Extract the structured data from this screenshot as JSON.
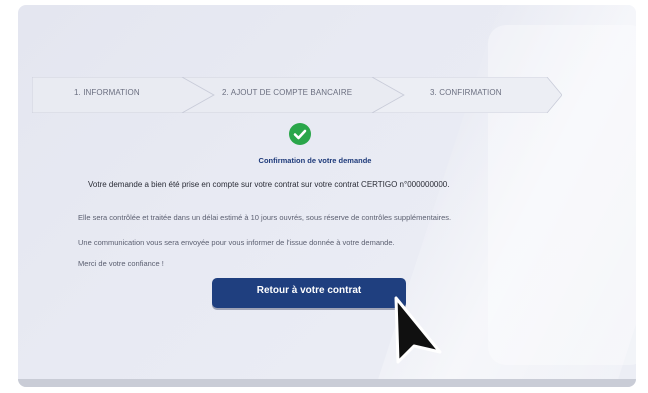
{
  "stepper": {
    "steps": [
      {
        "label": "1. INFORMATION"
      },
      {
        "label": "2. AJOUT DE COMPTE BANCAIRE"
      },
      {
        "label": "3. CONFIRMATION"
      }
    ]
  },
  "confirmation": {
    "title": "Confirmation de votre demande",
    "message": "Votre demande a bien été prise en compte sur votre contrat sur votre contrat CERTIGO n°000000000.",
    "details": [
      "Elle sera contrôlée et traitée dans un délai estimé à 10 jours ouvrés, sous réserve de contrôles supplémentaires.",
      "Une communication vous sera envoyée pour vous informer de l'issue donnée à votre demande.",
      "Merci de votre confiance !"
    ],
    "button_label": "Retour à votre contrat",
    "status_icon": "check-circle-icon"
  },
  "colors": {
    "primary": "#1f3f7f",
    "success": "#2aa64a",
    "background": "#e6e8f1"
  }
}
